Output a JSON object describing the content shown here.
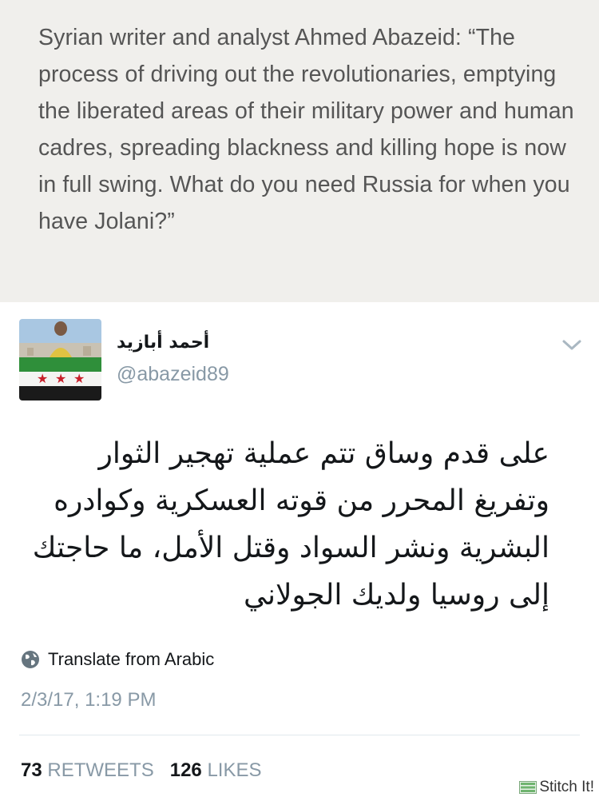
{
  "caption": {
    "text": "Syrian writer and analyst Ahmed Abazeid: “The process of driving out the revolutionaries, emptying the liberated areas of their military power and human cadres, spreading blackness and killing hope is now in full swing. What do you need Russia for when you have Jolani?”"
  },
  "tweet": {
    "display_name": "أحمد أبازيد",
    "handle": "@abazeid89",
    "avatar_icon": "profile-photo-with-syrian-revolution-flag",
    "menu_icon": "chevron-down-icon",
    "text": "على قدم وساق تتم عملية تهجير الثوار وتفريغ المحرر من قوته العسكرية وكوادره البشرية ونشر السواد وقتل الأمل، ما حاجتك إلى روسيا ولديك الجولاني",
    "translate_label": "Translate from Arabic",
    "translate_icon": "globe-icon",
    "timestamp": "2/3/17, 1:19 PM",
    "retweets_count": "73",
    "retweets_label": "RETWEETS",
    "likes_count": "126",
    "likes_label": "LIKES"
  },
  "watermark": {
    "label": "Stitch It!",
    "icon": "stitch-icon"
  },
  "colors": {
    "caption_bg": "#f0efec",
    "caption_text": "#555555",
    "secondary_text": "#8899a6",
    "primary_text": "#14171a"
  }
}
